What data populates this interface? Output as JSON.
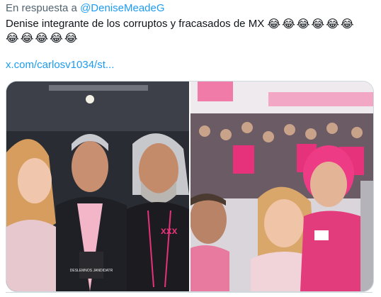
{
  "reply": {
    "prefix": "En respuesta a",
    "mention": "@DeniseMeadeG"
  },
  "tweet": {
    "text": "Denise integrante de los corruptos y fracasados de MX",
    "emoji_line1": [
      "😂",
      "😂",
      "😂",
      "😂",
      "😂",
      "😂"
    ],
    "emoji_line2": [
      "😂",
      "😂",
      "😂",
      "😂",
      "😂"
    ],
    "link": "x.com/carlosv1034/st..."
  },
  "media": {
    "photos": [
      {
        "badge_text": "DESLEMNOS JANDIDATR"
      },
      {
        "badge_text": ""
      }
    ]
  },
  "colors": {
    "accent": "#1d9bf0",
    "pink": "#e5327a",
    "muted": "#536471"
  }
}
